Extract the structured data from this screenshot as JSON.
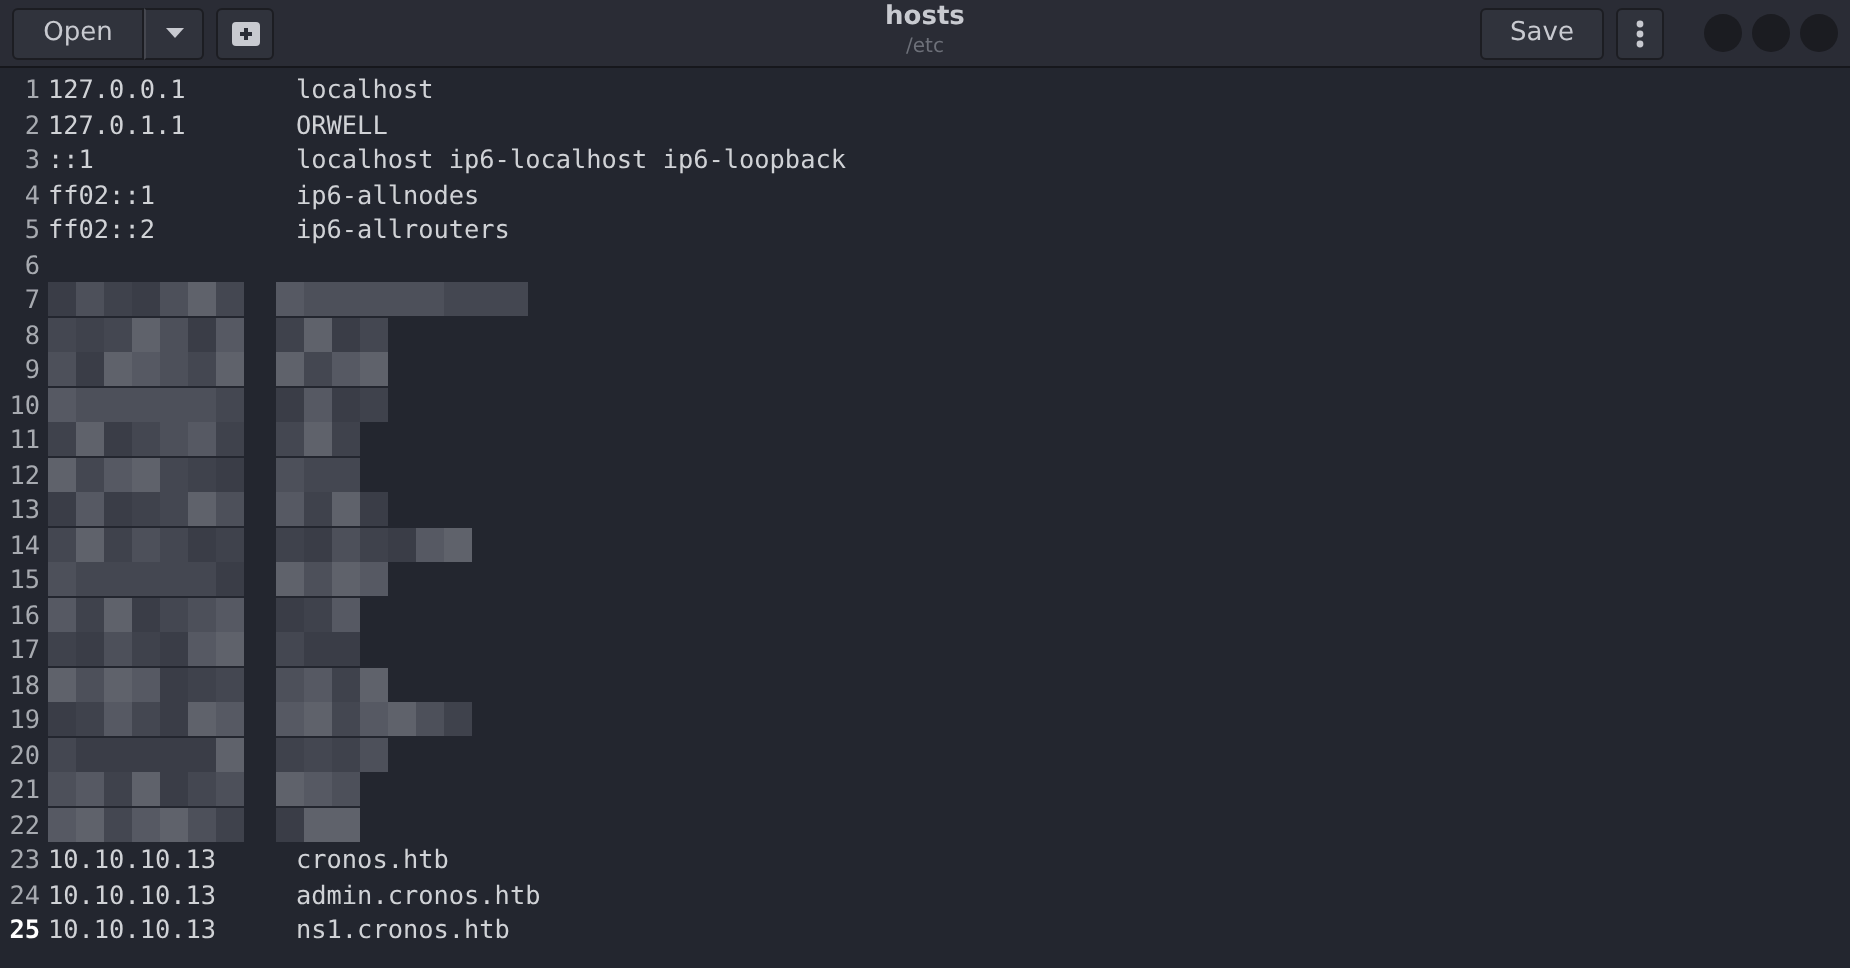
{
  "header": {
    "open_button": "Open",
    "title": "hosts",
    "subtitle": "/etc",
    "save_button": "Save"
  },
  "lines": [
    {
      "number": "1",
      "kind": "text",
      "current": false,
      "address": "127.0.0.1",
      "names": "localhost"
    },
    {
      "number": "2",
      "kind": "text",
      "current": false,
      "address": "127.0.1.1",
      "names": "ORWELL"
    },
    {
      "number": "3",
      "kind": "text",
      "current": false,
      "address": "::1",
      "names": "localhost ip6-localhost ip6-loopback"
    },
    {
      "number": "4",
      "kind": "text",
      "current": false,
      "address": "ff02::1",
      "names": "ip6-allnodes"
    },
    {
      "number": "5",
      "kind": "text",
      "current": false,
      "address": "ff02::2",
      "names": "ip6-allrouters"
    },
    {
      "number": "6",
      "kind": "empty",
      "current": false
    },
    {
      "number": "7",
      "kind": "redacted",
      "current": false
    },
    {
      "number": "8",
      "kind": "redacted",
      "current": false
    },
    {
      "number": "9",
      "kind": "redacted",
      "current": false
    },
    {
      "number": "10",
      "kind": "redacted",
      "current": false
    },
    {
      "number": "11",
      "kind": "redacted",
      "current": false
    },
    {
      "number": "12",
      "kind": "redacted",
      "current": false
    },
    {
      "number": "13",
      "kind": "redacted",
      "current": false
    },
    {
      "number": "14",
      "kind": "redacted",
      "current": false
    },
    {
      "number": "15",
      "kind": "redacted",
      "current": false
    },
    {
      "number": "16",
      "kind": "redacted",
      "current": false
    },
    {
      "number": "17",
      "kind": "redacted",
      "current": false
    },
    {
      "number": "18",
      "kind": "redacted",
      "current": false
    },
    {
      "number": "19",
      "kind": "redacted",
      "current": false
    },
    {
      "number": "20",
      "kind": "redacted",
      "current": false
    },
    {
      "number": "21",
      "kind": "redacted",
      "current": false
    },
    {
      "number": "22",
      "kind": "redacted",
      "current": false
    },
    {
      "number": "23",
      "kind": "text",
      "current": false,
      "address": "10.10.10.13",
      "names": "cronos.htb"
    },
    {
      "number": "24",
      "kind": "text",
      "current": false,
      "address": "10.10.10.13",
      "names": "admin.cronos.htb"
    },
    {
      "number": "25",
      "kind": "text",
      "current": true,
      "address": "10.10.10.13",
      "names": "ns1.cronos.htb"
    }
  ]
}
